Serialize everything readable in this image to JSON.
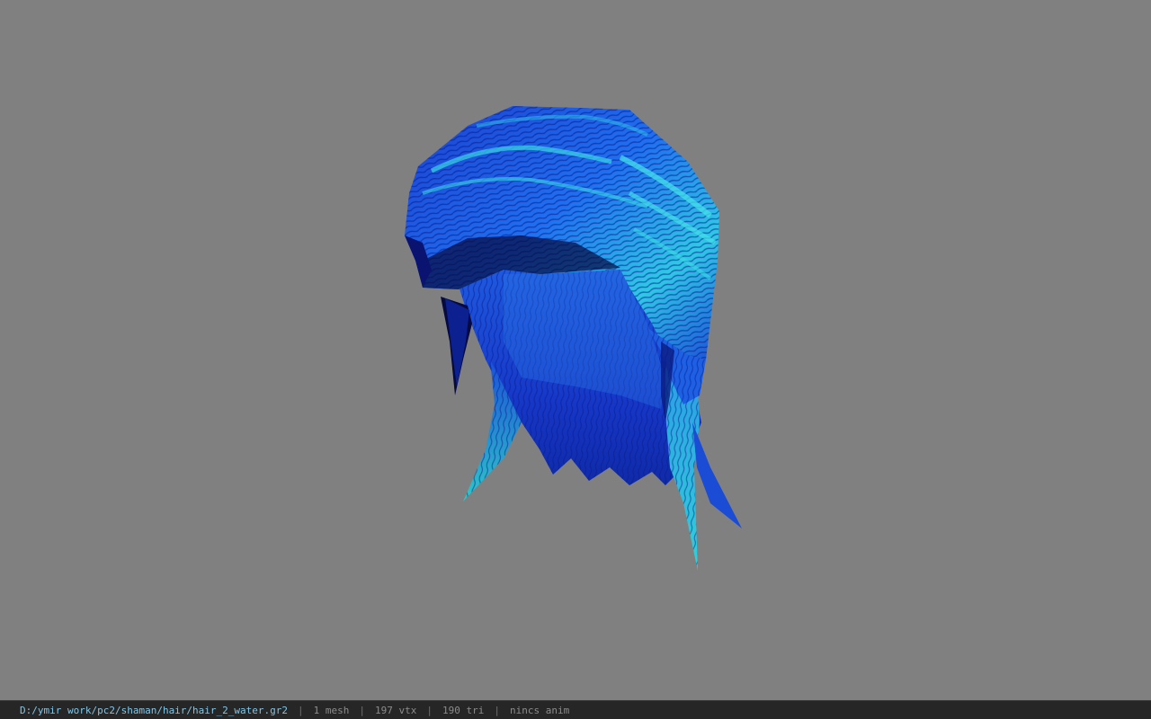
{
  "viewport": {
    "background_color": "#808080",
    "model_name": "hair-mesh",
    "texture_colors": {
      "dark": "#0a1a9a",
      "mid": "#1a4ad8",
      "bright": "#1c7cf0",
      "cyan": "#2fd0e0",
      "shadow": "#060a40"
    }
  },
  "status_bar": {
    "path": "D:/ymir work/pc2/shaman/hair/hair_2_water.gr2",
    "mesh_count": "1 mesh",
    "vertex_count": "197 vtx",
    "triangle_count": "190 tri",
    "anim_status": "nincs anim",
    "separator": "|"
  }
}
